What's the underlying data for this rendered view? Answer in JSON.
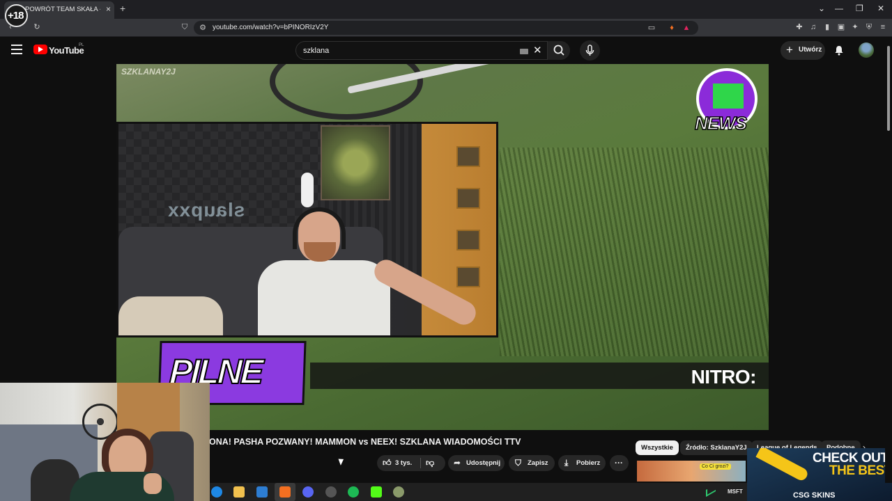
{
  "browser": {
    "tab_title": "POWRÓT TEAM SKAŁA - GUC",
    "tab_close": "×",
    "new_tab": "+",
    "url": "youtube.com/watch?v=bPINORIzV2Y",
    "window_controls": {
      "minimize": "—",
      "maximize": "❐",
      "close": "✕",
      "tabs_dropdown": "⌄"
    }
  },
  "youtube": {
    "logo_text": "YouTube",
    "region": "PL",
    "search_value": "szklana",
    "create_label": "Utwórz",
    "brand_color": "#ff0000"
  },
  "video": {
    "channel_watermark": "SZKLANAY2J",
    "news_logo_text": "NEWS",
    "banner_text": "PILNE",
    "ticker_text": "NITRO:",
    "accent_color": "#8b3ae0",
    "title": "ONA! PASHA POZWANY! MAMMON vs NEEX! SZKLANA WIADOMOŚCI TTV"
  },
  "actions": {
    "likes": "3 tys.",
    "share": "Udostępnij",
    "save": "Zapisz",
    "download": "Pobierz",
    "more": "···"
  },
  "chips": [
    {
      "label": "Wszystkie",
      "active": true
    },
    {
      "label": "Źródło: SzklanaY2J",
      "active": false
    },
    {
      "label": "League of Legends",
      "active": false
    },
    {
      "label": "Podobne",
      "active": false
    }
  ],
  "recommendation": {
    "bubble_text": "Co Ci grozi?"
  },
  "ad": {
    "line1": "CHECK OUT",
    "line2": "THE BEST",
    "brand": "CSG SKINS"
  },
  "overlay": {
    "age_badge": "+18"
  },
  "taskbar": {
    "stock_ticker": "MSFT"
  },
  "icons": [
    "menu-icon",
    "youtube-logo-icon",
    "search-icon",
    "mic-icon",
    "bell-icon",
    "like-icon",
    "dislike-icon",
    "share-icon",
    "save-icon",
    "download-icon",
    "more-icon"
  ]
}
